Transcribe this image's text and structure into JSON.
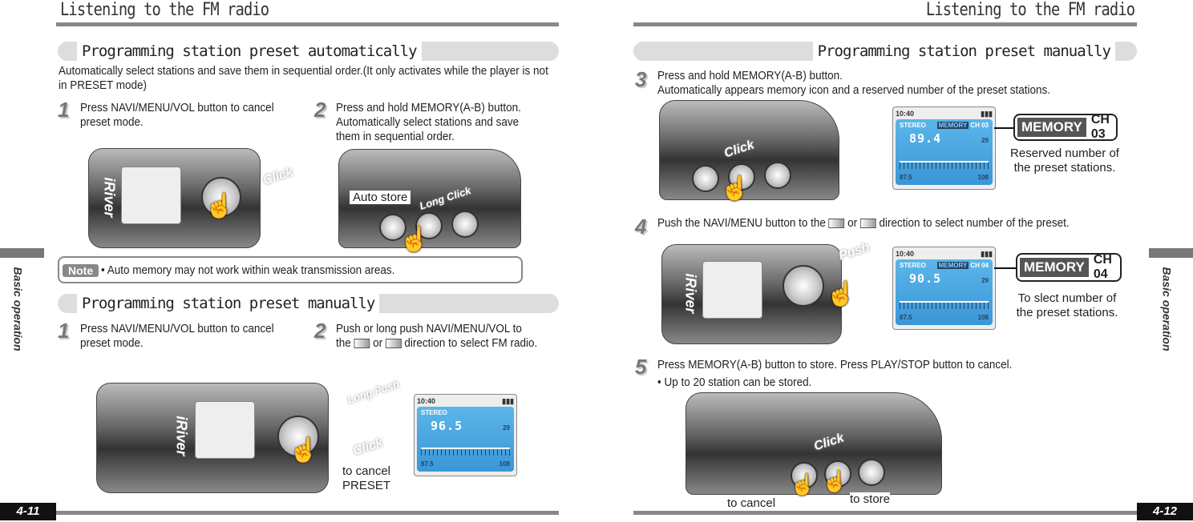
{
  "left_page": {
    "header": "Listening to the FM radio",
    "section1": {
      "title": "Programming station preset automatically",
      "description": "Automatically select stations and save them in sequential order.(It only activates while the player is not in PRESET mode)",
      "steps": [
        {
          "num": "1",
          "text": "Press NAVI/MENU/VOL button to cancel preset mode."
        },
        {
          "num": "2",
          "text": "Press and hold MEMORY(A-B) button. Automatically select stations and save them in sequential order."
        }
      ],
      "bubbles": {
        "click": "Click",
        "long_click": "Long Click"
      },
      "auto_store_label": "Auto store"
    },
    "note": {
      "label": "Note",
      "text": "• Auto memory may not work within weak transmission areas."
    },
    "section2": {
      "title": "Programming station preset manually",
      "steps": [
        {
          "num": "1",
          "text": "Press NAVI/MENU/VOL button to cancel preset mode."
        },
        {
          "num": "2",
          "text_a": "Push or long push NAVI/MENU/VOL to the",
          "text_or": "or",
          "text_b": "direction to select FM radio."
        }
      ],
      "bubbles": {
        "long_push": "Long Push",
        "click": "Click"
      },
      "cancel_label": "to cancel PRESET"
    },
    "side_tab": "Basic operation",
    "page_number": "4-11"
  },
  "right_page": {
    "header": "Listening to the FM radio",
    "section": {
      "title": "Programming station preset manually",
      "steps": [
        {
          "num": "3",
          "line1": "Press and hold MEMORY(A-B) button.",
          "line2": "Automatically appears memory icon and a reserved number of the preset stations."
        },
        {
          "num": "4",
          "text_a": "Push the NAVI/MENU button to the",
          "text_or": "or",
          "text_b": "direction to select number of the preset."
        },
        {
          "num": "5",
          "line1": "Press MEMORY(A-B) button to store. Press PLAY/STOP button to cancel.",
          "line2": "• Up to 20 station can be stored."
        }
      ],
      "bubbles": {
        "click": "Click",
        "push": "Push",
        "click2": "Click"
      },
      "callout3": {
        "memory": "MEMORY",
        "ch": "CH 03",
        "caption": "Reserved number of the preset stations."
      },
      "callout4": {
        "memory": "MEMORY",
        "ch": "CH 04",
        "caption": "To slect number of the preset stations."
      },
      "to_cancel": "to cancel",
      "to_store": "to store"
    },
    "side_tab": "Basic operation",
    "page_number": "4-12"
  },
  "lcd": {
    "time": "10:40",
    "stereo": "STEREO",
    "volume": "29",
    "low": "87.5",
    "high": "108",
    "memory": "MEMORY",
    "screens": [
      {
        "freq": "96.5"
      },
      {
        "freq": "89.4",
        "ch": "CH 03"
      },
      {
        "freq": "90.5",
        "ch": "CH 04"
      }
    ]
  },
  "device_logo": "iRiver",
  "colors": {
    "header_rule": "#888888",
    "section_bar": "#dddddd",
    "lcd_blue": "#3a96d6"
  }
}
